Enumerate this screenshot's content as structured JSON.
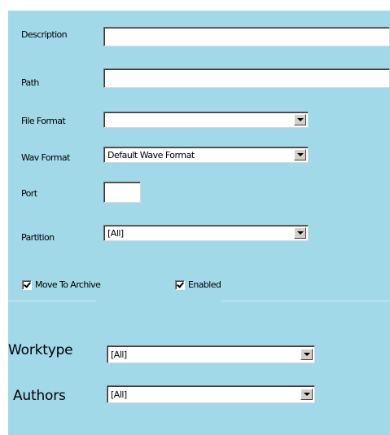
{
  "form": {
    "description": {
      "label": "Description",
      "value": ""
    },
    "path": {
      "label": "Path",
      "value": ""
    },
    "file_format": {
      "label": "File Format",
      "value": ""
    },
    "wav_format": {
      "label": "Wav Format",
      "value": "Default Wave Format"
    },
    "port": {
      "label": "Port",
      "value": ""
    },
    "partition": {
      "label": "Partition",
      "value": "[All]"
    },
    "move_to_archive": {
      "label": "Move To Archive",
      "checked": true
    },
    "enabled": {
      "label": "Enabled",
      "checked": true
    },
    "worktype": {
      "label": "Worktype",
      "value": "[All]"
    },
    "authors": {
      "label": "Authors",
      "value": "[All]"
    }
  },
  "colors": {
    "panel_background": "#a2d9e9",
    "field_background": "#ffffff"
  },
  "icons": {
    "dropdown_button": "chevron-down-icon",
    "checkbox_mark": "checkmark-icon"
  }
}
